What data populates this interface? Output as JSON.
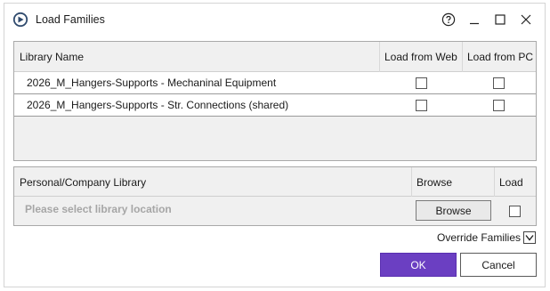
{
  "window": {
    "title": "Load Families",
    "app_icon": "revit-circle-icon",
    "controls": [
      "help-icon",
      "minimize-icon",
      "maximize-icon",
      "close-icon"
    ]
  },
  "web_table": {
    "headers": {
      "library_name": "Library Name",
      "load_from_web": "Load from Web",
      "load_from_pc": "Load from PC"
    },
    "rows": [
      {
        "name": "2026_M_Hangers-Supports - Mechaninal Equipment",
        "load_from_web": false,
        "load_from_pc": false
      },
      {
        "name": "2026_M_Hangers-Supports - Str. Connections (shared)",
        "load_from_web": false,
        "load_from_pc": false
      }
    ]
  },
  "personal_table": {
    "headers": {
      "library": "Personal/Company Library",
      "browse": "Browse",
      "load": "Load"
    },
    "placeholder": "Please select library location",
    "browse_label": "Browse",
    "load_checked": false
  },
  "footer": {
    "override_label": "Override Families",
    "override_checked": true,
    "ok_label": "OK",
    "cancel_label": "Cancel"
  },
  "colors": {
    "accent": "#6b3fc2",
    "placeholder_text": "#a6a6a6",
    "table_bg": "#f0f0f0"
  }
}
